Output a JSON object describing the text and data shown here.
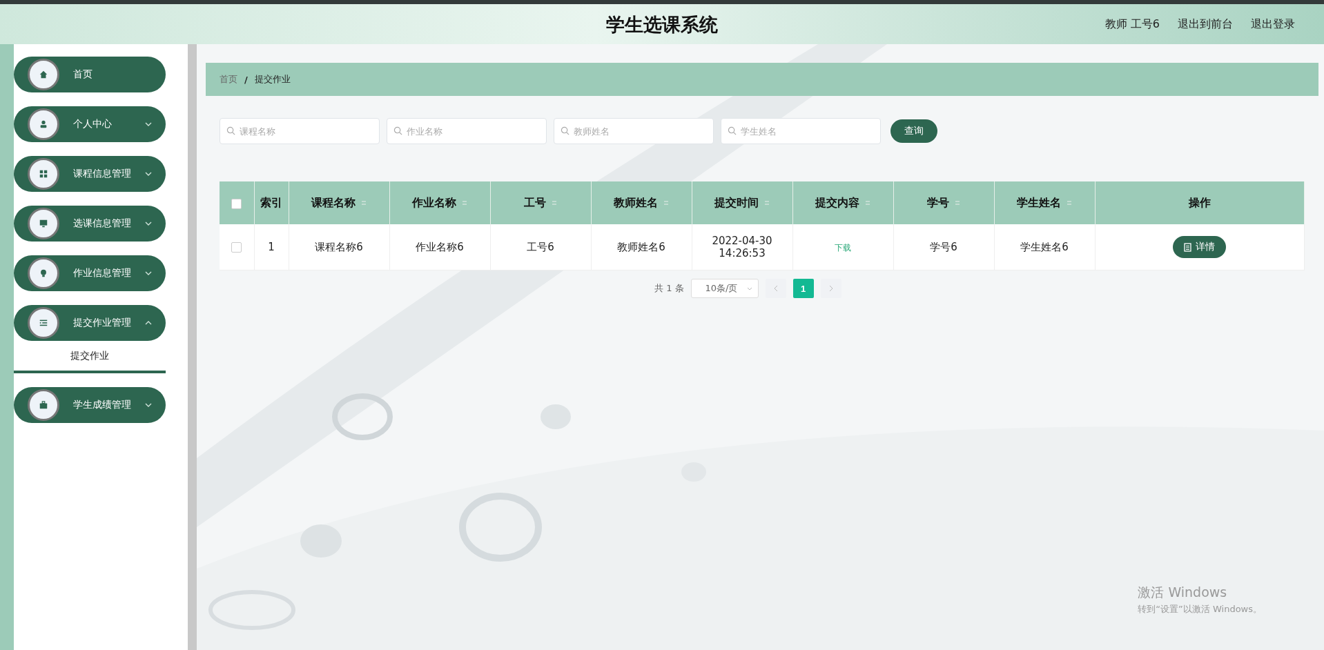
{
  "header": {
    "title": "学生选课系统",
    "user": "教师 工号6",
    "links": [
      "退出到前台",
      "退出登录"
    ]
  },
  "sidebar": {
    "items": [
      {
        "label": "首页",
        "expandable": false
      },
      {
        "label": "个人中心",
        "expandable": true,
        "expanded": false
      },
      {
        "label": "课程信息管理",
        "expandable": true,
        "expanded": false
      },
      {
        "label": "选课信息管理",
        "expandable": true,
        "expanded": false
      },
      {
        "label": "作业信息管理",
        "expandable": true,
        "expanded": false
      },
      {
        "label": "提交作业管理",
        "expandable": true,
        "expanded": true,
        "children": [
          {
            "label": "提交作业",
            "selected": true
          }
        ]
      },
      {
        "label": "学生成绩管理",
        "expandable": true,
        "expanded": false
      }
    ]
  },
  "breadcrumb": {
    "items": [
      "首页",
      "提交作业"
    ],
    "separator": "/"
  },
  "search": {
    "fields": [
      {
        "placeholder": "课程名称"
      },
      {
        "placeholder": "作业名称"
      },
      {
        "placeholder": "教师姓名"
      },
      {
        "placeholder": "学生姓名"
      }
    ],
    "button": "查询"
  },
  "table": {
    "all_checked": false,
    "columns": [
      {
        "label": "索引",
        "sortable": false
      },
      {
        "label": "课程名称",
        "sortable": true
      },
      {
        "label": "作业名称",
        "sortable": true
      },
      {
        "label": "工号",
        "sortable": true
      },
      {
        "label": "教师姓名",
        "sortable": true
      },
      {
        "label": "提交时间",
        "sortable": true
      },
      {
        "label": "提交内容",
        "sortable": true
      },
      {
        "label": "学号",
        "sortable": true
      },
      {
        "label": "学生姓名",
        "sortable": true
      },
      {
        "label": "操作",
        "sortable": false
      }
    ],
    "rows": [
      {
        "checked": false,
        "cells": [
          "1",
          "课程名称6",
          "作业名称6",
          "工号6",
          "教师姓名6",
          "2022-04-30 14:26:53"
        ],
        "download": "下载",
        "cells_after": [
          "学号6",
          "学生姓名6"
        ],
        "action": "详情"
      }
    ]
  },
  "pagination": {
    "total": "共 1 条",
    "page_size": "10条/页",
    "pages": [
      {
        "label": "1",
        "selected": true
      }
    ]
  },
  "os_notice": {
    "title": "激活 Windows",
    "text": "转到“设置”以激活 Windows。"
  }
}
